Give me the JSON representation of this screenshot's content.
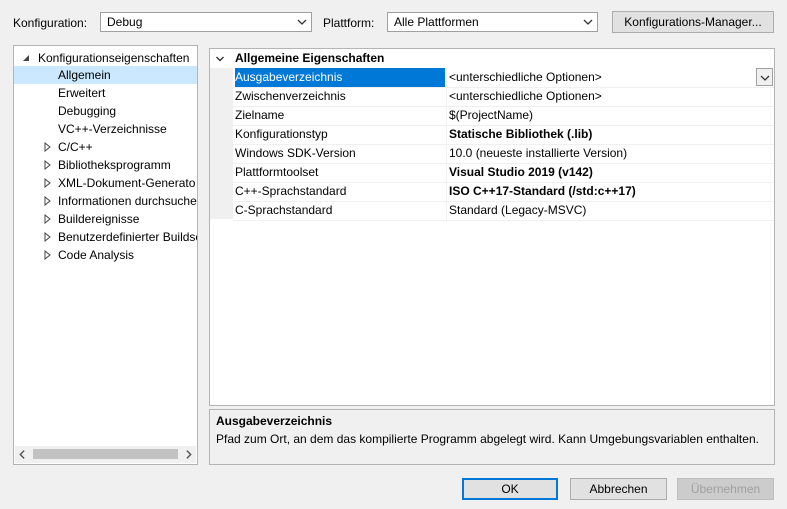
{
  "header": {
    "konfiguration_label": "Konfiguration:",
    "konfiguration_value": "Debug",
    "plattform_label": "Plattform:",
    "plattform_value": "Alle Plattformen",
    "manager_button": "Konfigurations-Manager..."
  },
  "tree": {
    "root_label": "Konfigurationseigenschaften",
    "items": [
      {
        "label": "Allgemein"
      },
      {
        "label": "Erweitert"
      },
      {
        "label": "Debugging"
      },
      {
        "label": "VC++-Verzeichnisse"
      },
      {
        "label": "C/C++"
      },
      {
        "label": "Bibliotheksprogramm"
      },
      {
        "label": "XML-Dokument-Generato"
      },
      {
        "label": "Informationen durchsuche"
      },
      {
        "label": "Buildereignisse"
      },
      {
        "label": "Benutzerdefinierter Buildsc"
      },
      {
        "label": "Code Analysis"
      }
    ]
  },
  "grid": {
    "category": "Allgemeine Eigenschaften",
    "rows": [
      {
        "name": "Ausgabeverzeichnis",
        "value": "<unterschiedliche Optionen>"
      },
      {
        "name": "Zwischenverzeichnis",
        "value": "<unterschiedliche Optionen>"
      },
      {
        "name": "Zielname",
        "value": "$(ProjectName)"
      },
      {
        "name": "Konfigurationstyp",
        "value": "Statische Bibliothek (.lib)"
      },
      {
        "name": "Windows SDK-Version",
        "value": "10.0 (neueste installierte Version)"
      },
      {
        "name": "Plattformtoolset",
        "value": "Visual Studio 2019 (v142)"
      },
      {
        "name": "C++-Sprachstandard",
        "value": "ISO C++17-Standard (/std:c++17)"
      },
      {
        "name": "C-Sprachstandard",
        "value": "Standard (Legacy-MSVC)"
      }
    ]
  },
  "description": {
    "title": "Ausgabeverzeichnis",
    "text": "Pfad zum Ort, an dem das kompilierte Programm abgelegt wird. Kann Umgebungsvariablen enthalten."
  },
  "buttons": {
    "ok": "OK",
    "cancel": "Abbrechen",
    "apply": "Übernehmen"
  },
  "colors": {
    "selection": "#0078d7",
    "tree_selection": "#cce8ff",
    "background": "#f0f0f0"
  }
}
